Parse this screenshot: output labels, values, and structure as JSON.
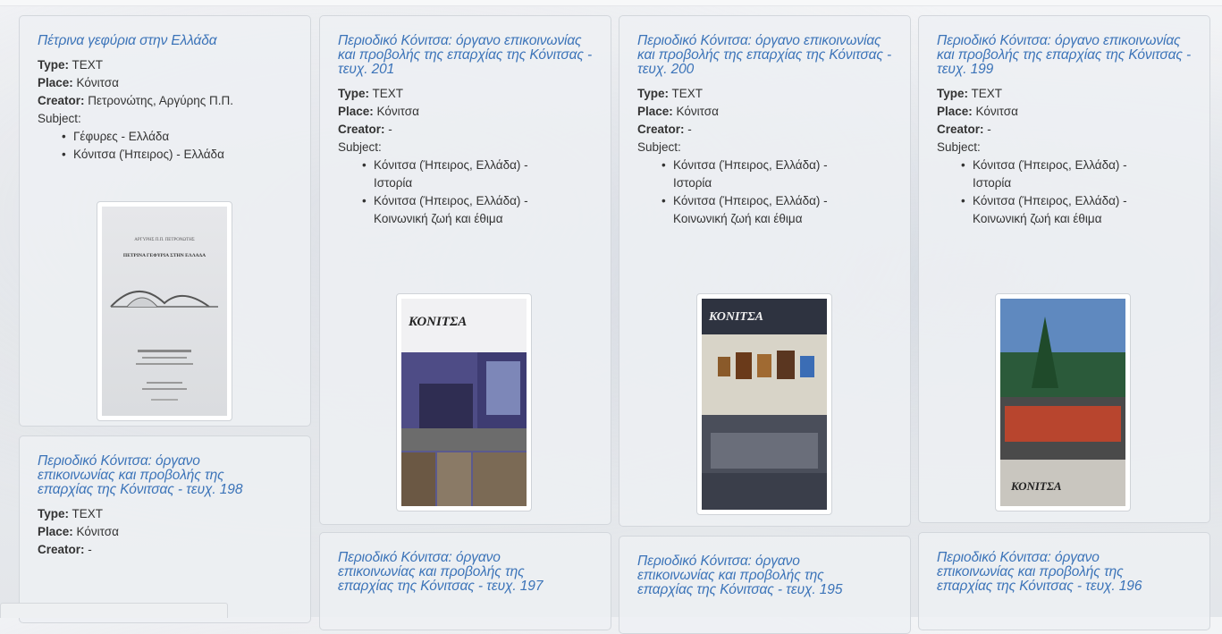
{
  "labels": {
    "type": "Type:",
    "place": "Place:",
    "creator": "Creator:",
    "subject": "Subject:"
  },
  "cards": [
    {
      "title": "Πέτρινα γεφύρια στην Ελλάδα",
      "type": "TEXT",
      "place": "Κόνιτσα",
      "creator": "Πετρονώτης, Αργύρης Π.Π.",
      "subjects": [
        "Γέφυρες - Ελλάδα",
        "Κόνιτσα (Ήπειρος) - Ελλάδα"
      ],
      "cover_text": [
        "ΑΡΓΥΡΗΣ Π.Π. ΠΕΤΡΟΝΩΤΗΣ",
        "ΠΕΤΡΙΝΑ ΓΕΦΥΡΙΑ ΣΤΗΝ ΕΛΛΑΔΑ"
      ]
    },
    {
      "title": "Περιοδικό Κόνιτσα: όργανο επικοινωνίας και προβολής της επαρχίας της Κόνιτσας - τευχ. 201",
      "type": "TEXT",
      "place": "Κόνιτσα",
      "creator": "-",
      "subjects": [
        "Κόνιτσα (Ήπειρος, Ελλάδα) - Ιστορία",
        "Κόνιτσα (Ήπειρος, Ελλάδα) - Κοινωνική ζωή και έθιμα"
      ],
      "cover_text": [
        "ΚΟΝΙΤΣΑ"
      ]
    },
    {
      "title": "Περιοδικό Κόνιτσα: όργανο επικοινωνίας και προβολής της επαρχίας της Κόνιτσας - τευχ. 200",
      "type": "TEXT",
      "place": "Κόνιτσα",
      "creator": "-",
      "subjects": [
        "Κόνιτσα (Ήπειρος, Ελλάδα) - Ιστορία",
        "Κόνιτσα (Ήπειρος, Ελλάδα) - Κοινωνική ζωή και έθιμα"
      ],
      "cover_text": [
        "ΚΟΝΙΤΣΑ"
      ]
    },
    {
      "title": "Περιοδικό Κόνιτσα: όργανο επικοινωνίας και προβολής της επαρχίας της Κόνιτσας - τευχ. 199",
      "type": "TEXT",
      "place": "Κόνιτσα",
      "creator": "-",
      "subjects": [
        "Κόνιτσα (Ήπειρος, Ελλάδα) - Ιστορία",
        "Κόνιτσα (Ήπειρος, Ελλάδα) - Κοινωνική ζωή και έθιμα"
      ],
      "cover_text": [
        "ΚΟΝΙΤΣΑ"
      ]
    },
    {
      "title": "Περιοδικό Κόνιτσα: όργανο επικοινωνίας και προβολής της επαρχίας της Κόνιτσας - τευχ. 198",
      "type": "TEXT",
      "place": "Κόνιτσα",
      "creator": "-"
    },
    {
      "title": "Περιοδικό Κόνιτσα: όργανο επικοινωνίας και προβολής της επαρχίας της Κόνιτσας - τευχ. 197"
    },
    {
      "title": "Περιοδικό Κόνιτσα: όργανο επικοινωνίας και προβολής της επαρχίας της Κόνιτσας - τευχ. 195"
    },
    {
      "title": "Περιοδικό Κόνιτσα: όργανο επικοινωνίας και προβολής της επαρχίας της Κόνιτσας - τευχ. 196"
    }
  ]
}
